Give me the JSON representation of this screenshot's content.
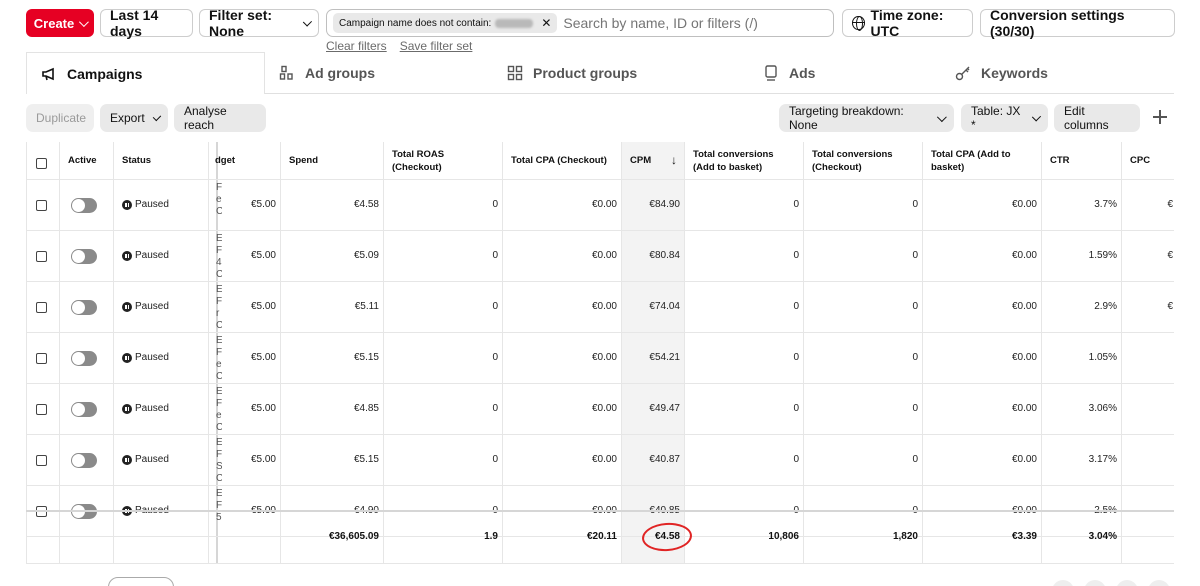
{
  "topbar": {
    "create_label": "Create",
    "date_range_label": "Last 14 days",
    "filter_set_label": "Filter set: None",
    "filter_chip_label": "Campaign name does not contain:",
    "search_placeholder": "Search by name, ID or filters (/)",
    "clear_filters": "Clear filters",
    "save_filter_set": "Save filter set",
    "timezone_label": "Time zone: UTC",
    "conversion_settings_label": "Conversion settings (30/30)"
  },
  "tabs": [
    "Campaigns",
    "Ad groups",
    "Product groups",
    "Ads",
    "Keywords"
  ],
  "toolbar": {
    "duplicate": "Duplicate",
    "export": "Export",
    "analyse_reach": "Analyse reach",
    "targeting_breakdown": "Targeting breakdown: None",
    "table": "Table: JX *",
    "edit_columns": "Edit columns"
  },
  "table": {
    "headers": {
      "active": "Active",
      "status": "Status",
      "budget": "dget",
      "spend": "Spend",
      "roas": "Total ROAS (Checkout)",
      "cpa": "Total CPA (Checkout)",
      "cpm": "CPM",
      "conv_add": "Total conversions (Add to basket)",
      "conv_checkout": "Total conversions (Checkout)",
      "cpa_add": "Total CPA (Add to basket)",
      "ctr": "CTR",
      "cpc": "CPC"
    },
    "rows": [
      {
        "status": "Paused",
        "name_frag": [
          "F",
          "e",
          "C"
        ],
        "budget": "€5.00",
        "spend": "€4.58",
        "roas": "0",
        "cpa": "€0.00",
        "cpm": "€84.90",
        "conv_add": "0",
        "conv_checkout": "0",
        "cpa_add": "€0.00",
        "ctr": "3.7%",
        "cpc": "€"
      },
      {
        "status": "Paused",
        "name_frag": [
          "E",
          "F",
          "4",
          "C"
        ],
        "budget": "€5.00",
        "spend": "€5.09",
        "roas": "0",
        "cpa": "€0.00",
        "cpm": "€80.84",
        "conv_add": "0",
        "conv_checkout": "0",
        "cpa_add": "€0.00",
        "ctr": "1.59%",
        "cpc": "€"
      },
      {
        "status": "Paused",
        "name_frag": [
          "E",
          "F",
          "r",
          "C"
        ],
        "budget": "€5.00",
        "spend": "€5.11",
        "roas": "0",
        "cpa": "€0.00",
        "cpm": "€74.04",
        "conv_add": "0",
        "conv_checkout": "0",
        "cpa_add": "€0.00",
        "ctr": "2.9%",
        "cpc": "€"
      },
      {
        "status": "Paused",
        "name_frag": [
          "E",
          "F",
          "e",
          "C"
        ],
        "budget": "€5.00",
        "spend": "€5.15",
        "roas": "0",
        "cpa": "€0.00",
        "cpm": "€54.21",
        "conv_add": "0",
        "conv_checkout": "0",
        "cpa_add": "€0.00",
        "ctr": "1.05%",
        "cpc": ""
      },
      {
        "status": "Paused",
        "name_frag": [
          "E",
          "F",
          "e",
          "C"
        ],
        "budget": "€5.00",
        "spend": "€4.85",
        "roas": "0",
        "cpa": "€0.00",
        "cpm": "€49.47",
        "conv_add": "0",
        "conv_checkout": "0",
        "cpa_add": "€0.00",
        "ctr": "3.06%",
        "cpc": ""
      },
      {
        "status": "Paused",
        "name_frag": [
          "E",
          "F",
          "S",
          "C"
        ],
        "budget": "€5.00",
        "spend": "€5.15",
        "roas": "0",
        "cpa": "€0.00",
        "cpm": "€40.87",
        "conv_add": "0",
        "conv_checkout": "0",
        "cpa_add": "€0.00",
        "ctr": "3.17%",
        "cpc": ""
      },
      {
        "status": "Paused",
        "name_frag": [
          "E",
          "F",
          "5"
        ],
        "budget": "€5.00",
        "spend": "€4.90",
        "roas": "0",
        "cpa": "€0.00",
        "cpm": "€40.85",
        "conv_add": "0",
        "conv_checkout": "0",
        "cpa_add": "€0.00",
        "ctr": "2.5%",
        "cpc": ""
      }
    ],
    "totals": {
      "spend": "€36,605.09",
      "roas": "1.9",
      "cpa": "€20.11",
      "cpm": "€4.58",
      "conv_add": "10,806",
      "conv_checkout": "1,820",
      "cpa_add": "€3.39",
      "ctr": "3.04%"
    }
  },
  "colors": {
    "brand_red": "#e60023",
    "annotation_circle": "#e02424"
  }
}
